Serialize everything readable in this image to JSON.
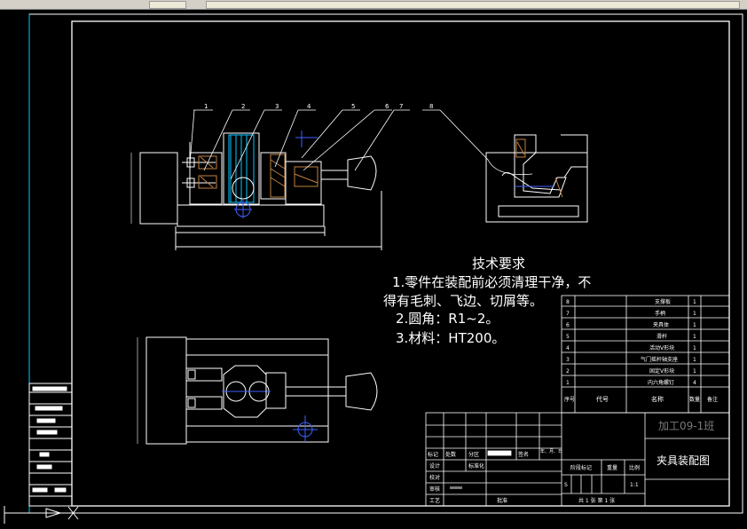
{
  "notes": {
    "title": "技术要求",
    "line1": "1.零件在装配前必须清理干净，不",
    "line2": "得有毛刺、飞边、切屑等。",
    "line3": "2.圆角：R1~2。",
    "line4": "3.材料：HT200。"
  },
  "balloons": [
    "1",
    "2",
    "3",
    "4",
    "5",
    "6",
    "7",
    "8"
  ],
  "bom": {
    "rows": [
      {
        "no": "8",
        "name": "支撑板",
        "qty": "1"
      },
      {
        "no": "7",
        "name": "手柄",
        "qty": "1"
      },
      {
        "no": "6",
        "name": "夹具体",
        "qty": "1"
      },
      {
        "no": "5",
        "name": "滑杆",
        "qty": "1"
      },
      {
        "no": "4",
        "name": "活动V形块",
        "qty": "1"
      },
      {
        "no": "3",
        "name": "气门摇杆轴支座",
        "qty": "1"
      },
      {
        "no": "2",
        "name": "固定V形块",
        "qty": "1"
      },
      {
        "no": "1",
        "name": "内六角螺钉",
        "qty": "4"
      }
    ],
    "header": {
      "seq": "序号",
      "code": "代号",
      "name": "名称",
      "qty": "数量",
      "remark": "备注"
    }
  },
  "title_block": {
    "org": "加工09-1班",
    "drawing_name": "夹具装配图",
    "mark": "标记",
    "count": "处数",
    "zone": "分区",
    "sign": "签名",
    "date": "年、月、日",
    "design": "设计",
    "standard": "标准化",
    "check": "校对",
    "review": "审核",
    "process": "工艺",
    "approve": "批准",
    "stage_mark": "阶段标记",
    "weight": "重量",
    "scale": "比例",
    "stage_s": "S",
    "scale_value": "1:1",
    "sheets": "共 1 张  第 1 张"
  },
  "colors": {
    "line": "#ffffff",
    "cyan": "#00c8ff",
    "blue": "#4060ff",
    "orange": "#c08040",
    "title_org": "#7a7a7a"
  }
}
